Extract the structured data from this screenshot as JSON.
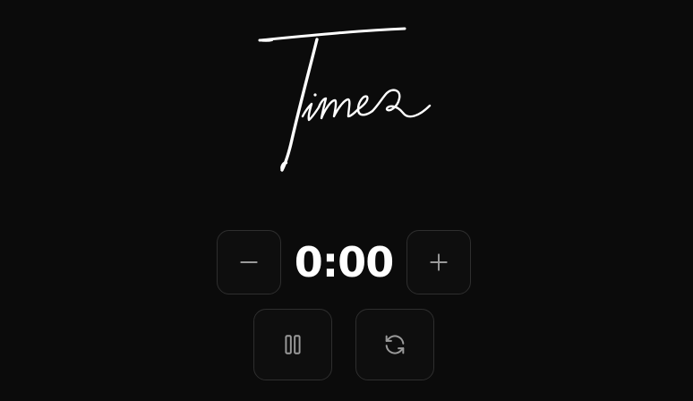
{
  "header": {
    "title": "Timer"
  },
  "timer": {
    "display": "0:00"
  },
  "controls": {
    "decrease_icon": "minus-icon",
    "increase_icon": "plus-icon",
    "pause_icon": "pause-icon",
    "reset_icon": "reset-icon"
  },
  "colors": {
    "background": "#0b0b0b",
    "text": "#ffffff",
    "button_border": "#2e2e2e",
    "icon": "#9a9a9a"
  }
}
